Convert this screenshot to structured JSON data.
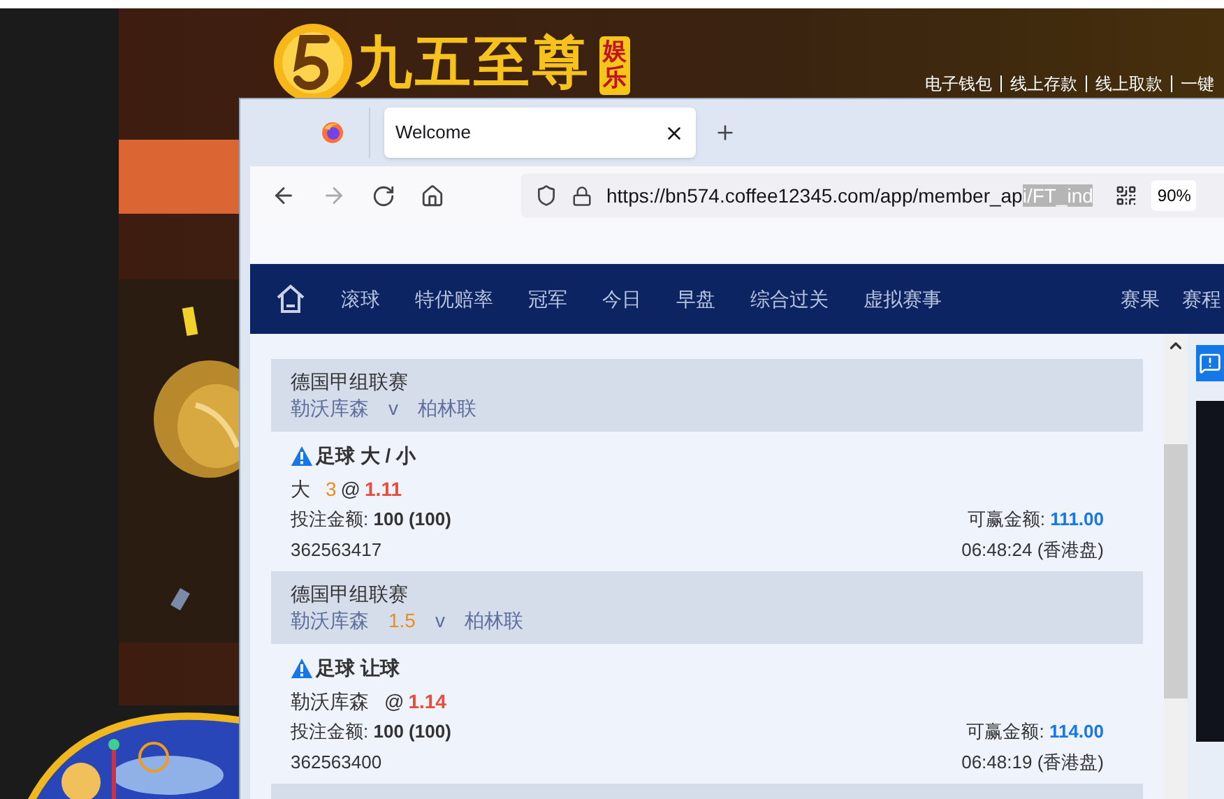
{
  "site": {
    "logo_text": "九五至尊",
    "logo_badge": "娱乐",
    "header_links": [
      "电子钱包",
      "线上存款",
      "线上取款",
      "一键"
    ]
  },
  "browser": {
    "tab": {
      "title": "Welcome",
      "selected": true
    },
    "url_plain": "https://bn574.coffee12345.com/app/member_ap",
    "url_selected": "i/FT_ind",
    "zoom": "90%"
  },
  "nav": {
    "items": [
      "滚球",
      "特优赔率",
      "冠军",
      "今日",
      "早盘",
      "综合过关",
      "虚拟赛事"
    ],
    "right_items": [
      "赛果",
      "赛程"
    ]
  },
  "bets": [
    {
      "league": "德国甲组联赛",
      "home": "勒沃库森",
      "versus": "v",
      "away": "柏林联",
      "market": "足球 大 / 小",
      "selection": "大",
      "line": "3",
      "at": "@",
      "odds": "1.11",
      "stake_label": "投注金额:",
      "stake": "100 (100)",
      "win_label": "可赢金额:",
      "win": "111.00",
      "ticket": "362563417",
      "time": "06:48:24",
      "time_note": "(香港盘)"
    },
    {
      "league": "德国甲组联赛",
      "home": "勒沃库森",
      "handicap": "1.5",
      "versus": "v",
      "away": "柏林联",
      "market": "足球 让球",
      "selection": "勒沃库森",
      "at": "@",
      "odds": "1.14",
      "stake_label": "投注金额:",
      "stake": "100 (100)",
      "win_label": "可赢金额:",
      "win": "114.00",
      "ticket": "362563400",
      "time": "06:48:19",
      "time_note": "(香港盘)"
    }
  ]
}
